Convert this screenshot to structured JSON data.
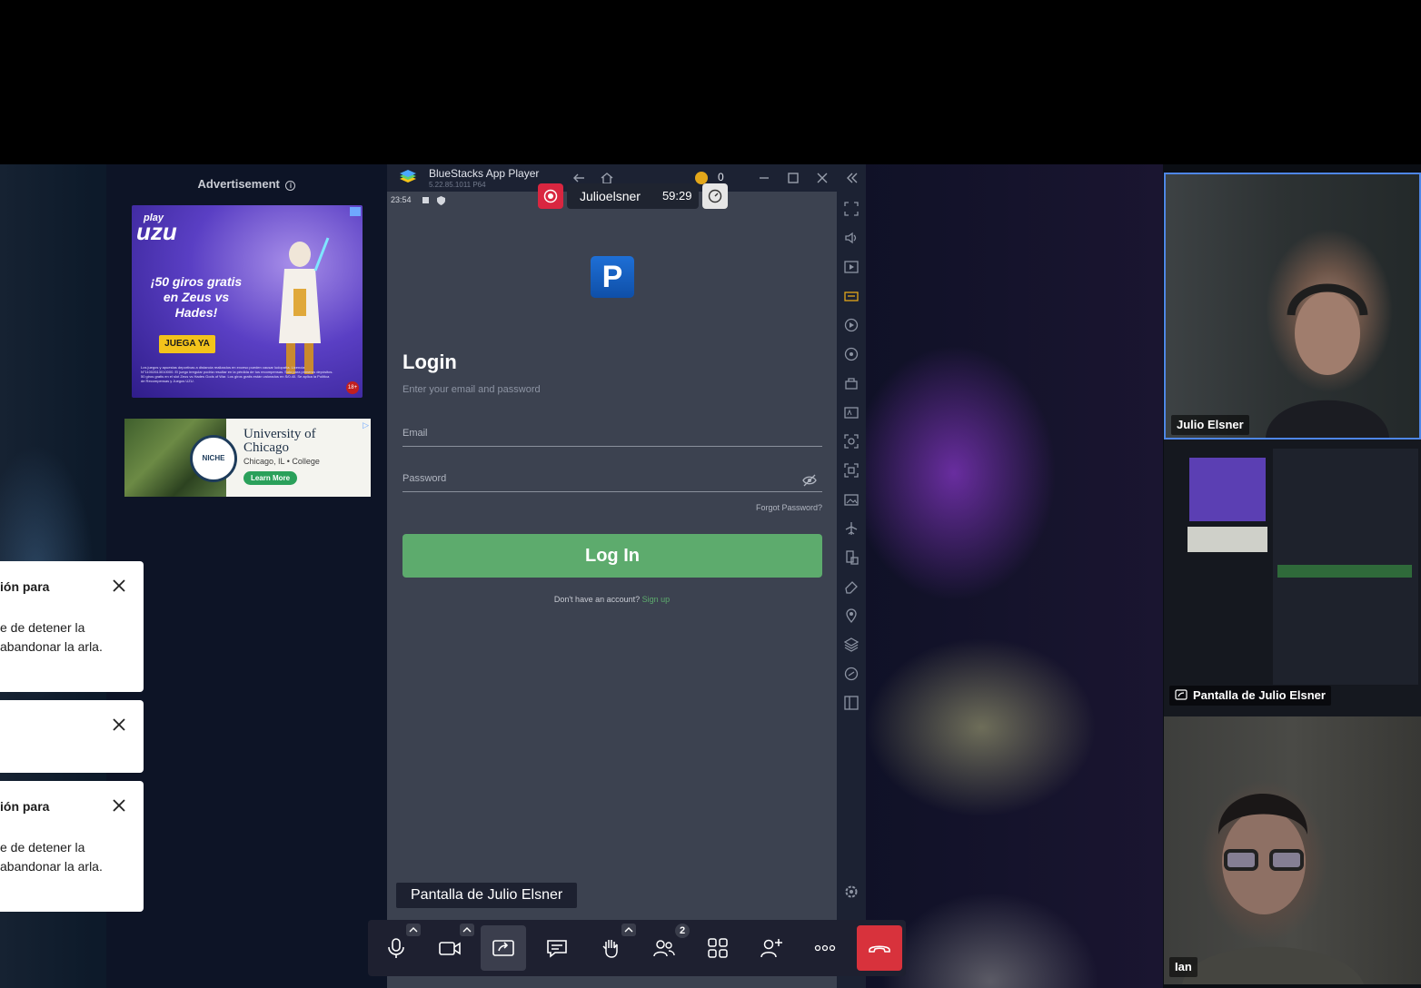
{
  "advertisement": {
    "label": "Advertisement",
    "info_icon": "info-icon",
    "uzu": {
      "logo_top": "play",
      "logo": "uzu",
      "promo": "¡50 giros gratis en Zeus vs Hades!",
      "cta": "JUEGA YA",
      "fine_print": "Los juegos y apuestas deportivas a distancia realizados en exceso pueden causar ludopatía. Licencia N°11002613010000. El juego irregular podría resultar en la pérdida de tus recompensas. Solo para primeros depósitos. 50 giros gratis en el slot Zeus vs Hades Gods of War. Los giros gratis están valorados en S/0.40. Se aplica la Política de Recompensas y Juegos UZU.",
      "age": "18+"
    },
    "uchicago": {
      "seal": "NICHE",
      "name": "University of Chicago",
      "location": "Chicago, IL • College",
      "cta": "Learn More",
      "adchoice": "▷"
    }
  },
  "toasts": [
    {
      "title": "ión para",
      "body": "e de detener la abandonar la arla."
    },
    {
      "title": "",
      "body": ""
    },
    {
      "title": "ión para",
      "body": "e de detener la abandonar la arla."
    }
  ],
  "bluestacks": {
    "title": "BlueStacks App Player",
    "version": "5.22.85.1011 P64",
    "clock": "23:54",
    "coins": "0",
    "recording": {
      "name": "Julioelsner",
      "time": "59:29"
    },
    "app": {
      "icon_letter": "P",
      "heading": "Login",
      "subheading": "Enter your email and password",
      "email_placeholder": "Email",
      "password_placeholder": "Password",
      "forgot": "Forgot Password?",
      "login_button": "Log In",
      "no_account": "Don't have an account?",
      "signup": "Sign up"
    }
  },
  "screen_share_label": "Pantalla de Julio Elsner",
  "toolbar": {
    "participants_count": "2"
  },
  "participants": [
    {
      "name": "Julio Elsner"
    },
    {
      "name": "Pantalla de Julio Elsner"
    },
    {
      "name": "Ian"
    }
  ],
  "colors": {
    "accent_green": "#5dab6d",
    "hangup_red": "#d8323c",
    "active_speaker_border": "#4e86e6"
  }
}
